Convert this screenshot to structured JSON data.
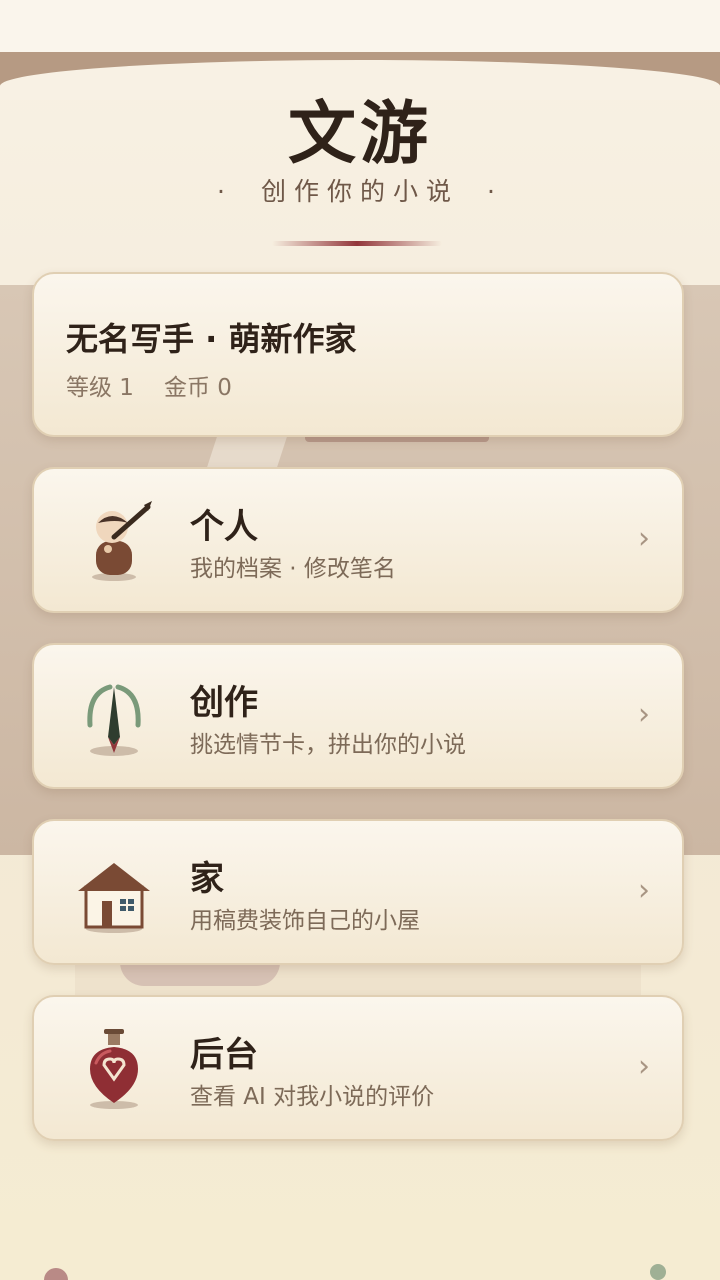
{
  "app": {
    "title": "文游",
    "subtitle": "创作你的小说",
    "subtitle_dot": "·"
  },
  "profile": {
    "name": "无名写手 · 萌新作家",
    "level_label": "等级 1",
    "coins_label": "金币 0"
  },
  "menu": [
    {
      "label": "个人",
      "desc": "我的档案 · 修改笔名",
      "icon": "writer-avatar-icon"
    },
    {
      "label": "创作",
      "desc": "挑选情节卡，拼出你的小说",
      "icon": "fountain-pen-icon"
    },
    {
      "label": "家",
      "desc": "用稿费装饰自己的小屋",
      "icon": "house-icon"
    },
    {
      "label": "后台",
      "desc": "查看 AI 对我小说的评价",
      "icon": "potion-bottle-icon"
    }
  ],
  "chevron": "›",
  "colors": {
    "accent": "#92363b",
    "background": "#f8f1e4",
    "card": "#fbf6ed",
    "text": "#2f2219"
  }
}
